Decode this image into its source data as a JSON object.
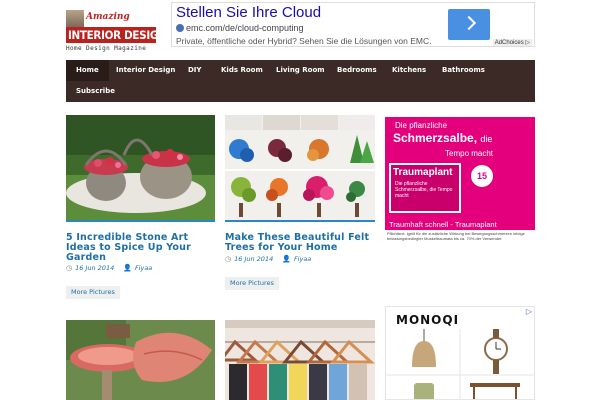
{
  "logo": {
    "amazing": "Amazing",
    "name": "INTERIOR DESIGN",
    "tagline": "Home Design Magazine"
  },
  "top_ad": {
    "title": "Stellen Sie Ihre Cloud",
    "url": "emc.com/de/cloud-computing",
    "description": "Private, öffentliche oder Hybrid? Sehen Sie die Lösungen von EMC.",
    "adchoices": "AdChoices ▷"
  },
  "nav": {
    "items": [
      "Home",
      "Interior Design",
      "DIY",
      "Kids Room",
      "Living Room",
      "Bedrooms",
      "Kitchens",
      "Bathrooms",
      "Subscribe"
    ],
    "active": "Home"
  },
  "posts": [
    {
      "title": "5 Incredible Stone Art Ideas to Spice Up Your Garden",
      "date": "16 Jun 2014",
      "author": "Fiyaa",
      "button": "More Pictures"
    },
    {
      "title": "Make These Beautiful Felt Trees for Your Home",
      "date": "16 Jun 2014",
      "author": "Fiyaa",
      "button": "More Pictures"
    }
  ],
  "side_ad1": {
    "line1": "Die pflanzliche",
    "line2": "Schmerzsalbe,",
    "line2b": "die",
    "line3": "Tempo macht",
    "brand": "Traumaplant",
    "pack_text": "Die pflanzliche Schmerzsalbe, die Tempo macht",
    "badge": "15",
    "slogan": "Traumhaft schnell - Traumaplant",
    "footer": "Pflichttext: Igelit für die zusätzliche Wirkung bei Bewegungsschmerzen infolge belastungsbedingter Muskeltraumata bis ca. 70% der Verwender."
  },
  "side_ad2": {
    "brand": "MONOQI",
    "close": "▷"
  },
  "icons": {
    "date": "clock-icon",
    "author": "user-icon"
  },
  "colors": {
    "nav_bg": "#3c2a26",
    "link": "#1d6fa5",
    "accent_border": "#2b86c5",
    "logo_red": "#b9231f",
    "ad_pink": "#e4007c"
  }
}
